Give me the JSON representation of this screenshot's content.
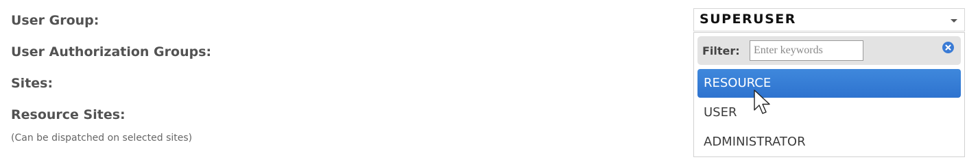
{
  "form": {
    "labels": {
      "user_group": "User Group:",
      "user_authorization_groups": "User Authorization Groups:",
      "sites": "Sites:",
      "resource_sites": "Resource Sites:"
    },
    "resource_sites_hint": "(Can be dispatched on selected sites)"
  },
  "user_group_select": {
    "value": "SUPERUSER",
    "filter_label": "Filter:",
    "filter_placeholder": "Enter keywords",
    "options": [
      {
        "label": "RESOURCE",
        "highlighted": true
      },
      {
        "label": "USER",
        "highlighted": false
      },
      {
        "label": "ADMINISTRATOR",
        "highlighted": false
      }
    ]
  },
  "icons": {
    "caret": "chevron-down-icon",
    "clear": "clear-filter-icon",
    "cursor": "mouse-pointer-icon"
  },
  "colors": {
    "highlight": "#3a7fd8",
    "clear_icon": "#3a7bd5",
    "filter_bar": "#e3e3e3"
  }
}
